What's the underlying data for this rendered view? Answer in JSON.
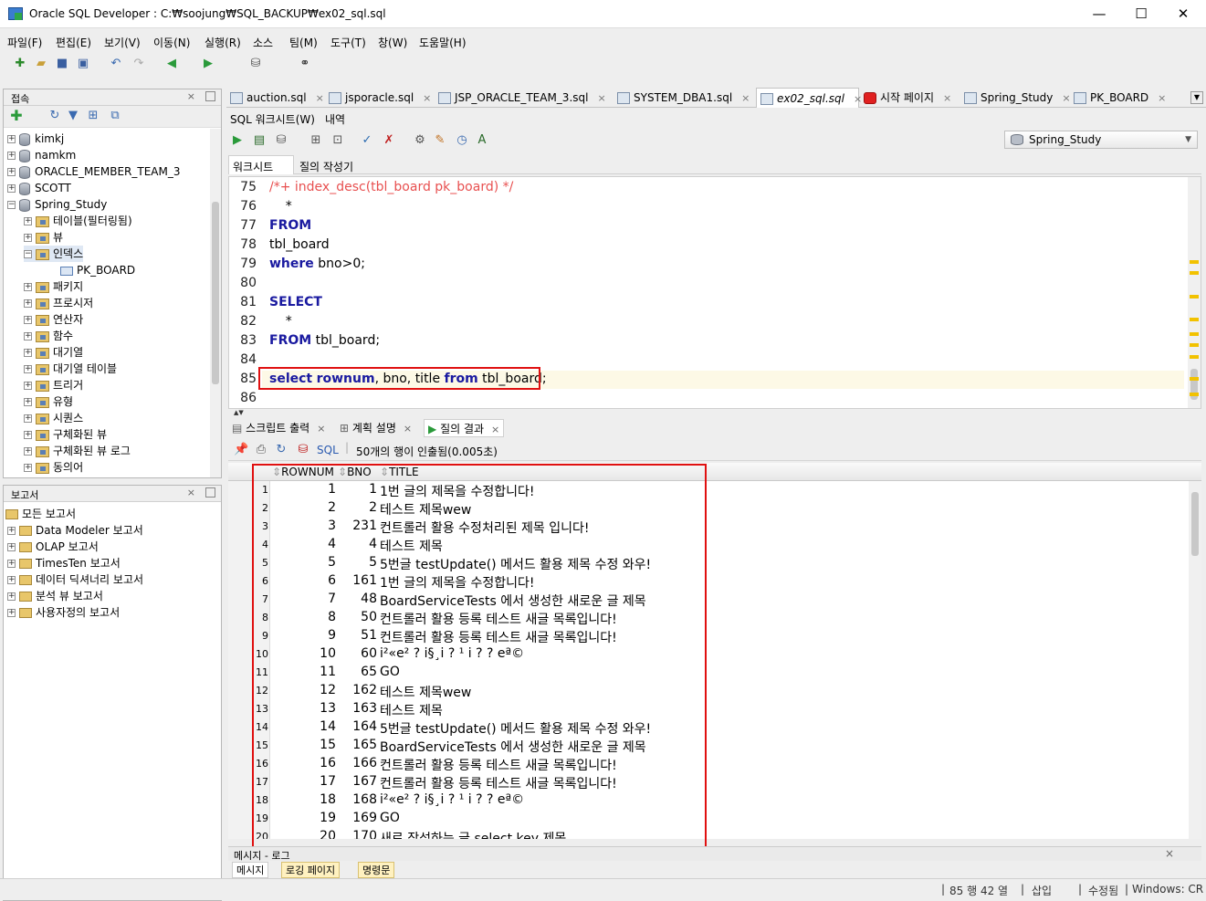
{
  "window": {
    "title": "Oracle SQL Developer : C:₩soojung₩SQL_BACKUP₩ex02_sql.sql",
    "minimize": "—",
    "maximize": "☐",
    "close": "✕"
  },
  "menu": [
    "파일(F)",
    "편집(E)",
    "보기(V)",
    "이동(N)",
    "실행(R)",
    "소스",
    "팀(M)",
    "도구(T)",
    "창(W)",
    "도움말(H)"
  ],
  "connections": {
    "title": "접속",
    "items": [
      "kimkj",
      "namkm",
      "ORACLE_MEMBER_TEAM_3",
      "SCOTT",
      "Spring_Study"
    ],
    "children": [
      "테이블(필터링됨)",
      "뷰",
      "인덱스",
      "패키지",
      "프로시저",
      "연산자",
      "함수",
      "대기열",
      "대기열 테이블",
      "트리거",
      "유형",
      "시퀀스",
      "구체화된 뷰",
      "구체화된 뷰 로그",
      "동의어"
    ],
    "index_child": "PK_BOARD"
  },
  "reports": {
    "title": "보고서",
    "items": [
      "모든 보고서",
      "Data Modeler 보고서",
      "OLAP 보고서",
      "TimesTen 보고서",
      "데이터 딕셔너리 보고서",
      "분석 뷰 보고서",
      "사용자정의 보고서"
    ]
  },
  "tabs": [
    "auction.sql",
    "jsporacle.sql",
    "JSP_ORACLE_TEAM_3.sql",
    "SYSTEM_DBA1.sql",
    "ex02_sql.sql",
    "시작 페이지",
    "Spring_Study",
    "PK_BOARD"
  ],
  "subtabs": {
    "worksheet": "SQL 워크시트(W)",
    "history": "내역"
  },
  "connection_selected": "Spring_Study",
  "query_tabs": {
    "worksheet": "워크시트",
    "builder": "질의 작성기"
  },
  "editor": {
    "lines": [
      {
        "n": "75",
        "text": "/*+ index_desc(tbl_board pk_board) */"
      },
      {
        "n": "76",
        "text": "    *"
      },
      {
        "n": "77",
        "text": "FROM"
      },
      {
        "n": "78",
        "text": "tbl_board"
      },
      {
        "n": "79a",
        "text": "where"
      },
      {
        "n": "79b",
        "text": " bno>"
      },
      {
        "n": "79c",
        "text": "0"
      },
      {
        "n": "79d",
        "text": ";"
      },
      {
        "n": "81",
        "text": "SELECT"
      },
      {
        "n": "82",
        "text": "    *"
      },
      {
        "n": "83a",
        "text": "FROM"
      },
      {
        "n": "83b",
        "text": " tbl_board;"
      },
      {
        "n": "85a",
        "text": "select"
      },
      {
        "n": "85b",
        "text": "rownum"
      },
      {
        "n": "85c",
        "text": ", bno, title "
      },
      {
        "n": "85d",
        "text": "from"
      },
      {
        "n": "85e",
        "text": " tbl_board;"
      }
    ],
    "line_numbers": [
      "75",
      "76",
      "77",
      "78",
      "79",
      "80",
      "81",
      "82",
      "83",
      "84",
      "85",
      "86"
    ]
  },
  "result_tabs": [
    "스크립트 출력",
    "계획 설명",
    "질의 결과"
  ],
  "result_bar": {
    "sql": "SQL",
    "status": "50개의 행이 인출됨(0.005초)"
  },
  "grid": {
    "columns": [
      "ROWNUM",
      "BNO",
      "TITLE"
    ],
    "rows": [
      [
        "1",
        "1",
        "1",
        "1번 글의 제목을 수정합니다!"
      ],
      [
        "2",
        "2",
        "2",
        "테스트 제목wew"
      ],
      [
        "3",
        "3",
        "231",
        "컨트롤러 활용 수정처리된 제목 입니다!"
      ],
      [
        "4",
        "4",
        "4",
        "테스트 제목"
      ],
      [
        "5",
        "5",
        "5",
        "5번글 testUpdate() 메서드 활용 제목 수정 와우!"
      ],
      [
        "6",
        "6",
        "161",
        "1번 글의 제목을 수정합니다!"
      ],
      [
        "7",
        "7",
        "48",
        "BoardServiceTests 에서 생성한 새로운 글 제목"
      ],
      [
        "8",
        "8",
        "50",
        "컨트롤러 활용 등록 테스트 새글 목록입니다!"
      ],
      [
        "9",
        "9",
        "51",
        "컨트롤러 활용 등록 테스트 새글 목록입니다!"
      ],
      [
        "10",
        "10",
        "60",
        "i²«e² ? i§¸i ? ¹ i ?  ? eª©"
      ],
      [
        "11",
        "11",
        "65",
        "GO"
      ],
      [
        "12",
        "12",
        "162",
        "테스트 제목wew"
      ],
      [
        "13",
        "13",
        "163",
        "테스트 제목"
      ],
      [
        "14",
        "14",
        "164",
        "5번글 testUpdate() 메서드 활용 제목 수정 와우!"
      ],
      [
        "15",
        "15",
        "165",
        "BoardServiceTests 에서 생성한 새로운 글 제목"
      ],
      [
        "16",
        "16",
        "166",
        "컨트롤러 활용 등록 테스트 새글 목록입니다!"
      ],
      [
        "17",
        "17",
        "167",
        "컨트롤러 활용 등록 테스트 새글 목록입니다!"
      ],
      [
        "18",
        "18",
        "168",
        "i²«e² ? i§¸i ? ¹ i ?  ? eª©"
      ],
      [
        "19",
        "19",
        "169",
        "GO"
      ],
      [
        "20",
        "20",
        "170",
        "새로 작성하는 글 select key 제목"
      ]
    ]
  },
  "messages": {
    "title": "메시지 - 로그",
    "tabs": [
      "메시지",
      "로깅 페이지",
      "명령문"
    ]
  },
  "status": {
    "position": "85 행 42 열",
    "mode": "삽입",
    "modified": "수정됨",
    "lineend": "Windows: CR"
  }
}
